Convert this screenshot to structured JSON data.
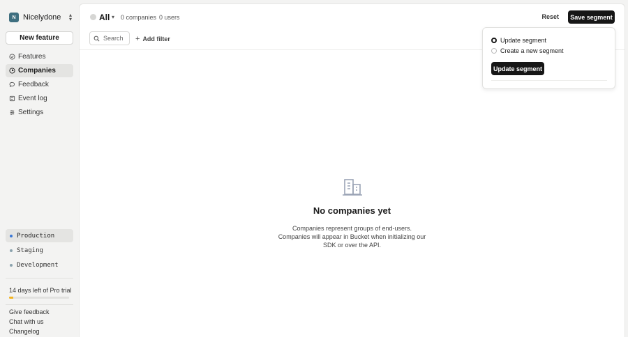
{
  "org": {
    "initial": "N",
    "name": "Nicelydone"
  },
  "sidebar": {
    "new_feature_label": "New feature",
    "nav": [
      {
        "label": "Features",
        "icon": "features-icon",
        "active": false
      },
      {
        "label": "Companies",
        "icon": "companies-icon",
        "active": true
      },
      {
        "label": "Feedback",
        "icon": "feedback-icon",
        "active": false
      },
      {
        "label": "Event log",
        "icon": "event-log-icon",
        "active": false
      },
      {
        "label": "Settings",
        "icon": "settings-icon",
        "active": false
      }
    ],
    "environments": [
      {
        "label": "Production",
        "active": true
      },
      {
        "label": "Staging",
        "active": false
      },
      {
        "label": "Development",
        "active": false
      }
    ],
    "trial": {
      "text": "14 days left of Pro trial",
      "progress": 0.07,
      "bar_color": "#f2b320"
    },
    "links": [
      "Give feedback",
      "Chat with us",
      "Changelog"
    ]
  },
  "header": {
    "segment_label": "All",
    "companies_count": "0 companies",
    "users_count": "0 users",
    "reset_label": "Reset",
    "save_segment_label": "Save segment"
  },
  "filters": {
    "search_placeholder": "Search",
    "add_filter_label": "Add filter"
  },
  "popover": {
    "options": [
      {
        "label": "Update segment",
        "checked": true
      },
      {
        "label": "Create a new segment",
        "checked": false
      }
    ],
    "button_label": "Update segment"
  },
  "empty_state": {
    "title": "No companies yet",
    "text": "Companies represent groups of end-users. Companies will appear in Bucket when initializing our SDK or over the API."
  }
}
